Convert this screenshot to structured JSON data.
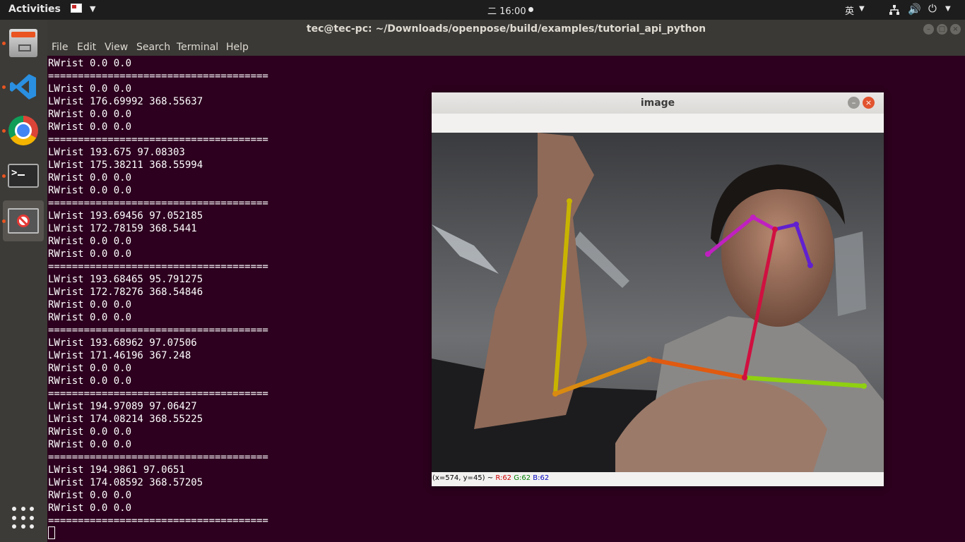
{
  "topbar": {
    "activities": "Activities",
    "clock": "二 16:00",
    "ime": "英",
    "status_icons": [
      "network-icon",
      "volume-icon",
      "power-icon"
    ]
  },
  "dock": {
    "apps": [
      "files-icon",
      "vscode-icon",
      "chrome-icon",
      "terminal-icon",
      "blocked-app-icon"
    ]
  },
  "terminal": {
    "title": "tec@tec-pc: ~/Downloads/openpose/build/examples/tutorial_api_python",
    "menu": [
      "File",
      "Edit",
      "View",
      "Search",
      "Terminal",
      "Help"
    ],
    "lines": [
      "RWrist 0.0 0.0",
      "=====================================",
      "LWrist 0.0 0.0",
      "LWrist 176.69992 368.55637",
      "RWrist 0.0 0.0",
      "RWrist 0.0 0.0",
      "=====================================",
      "LWrist 193.675 97.08303",
      "LWrist 175.38211 368.55994",
      "RWrist 0.0 0.0",
      "RWrist 0.0 0.0",
      "=====================================",
      "LWrist 193.69456 97.052185",
      "LWrist 172.78159 368.5441",
      "RWrist 0.0 0.0",
      "RWrist 0.0 0.0",
      "=====================================",
      "LWrist 193.68465 95.791275",
      "LWrist 172.78276 368.54846",
      "RWrist 0.0 0.0",
      "RWrist 0.0 0.0",
      "=====================================",
      "LWrist 193.68962 97.07506",
      "LWrist 171.46196 367.248",
      "RWrist 0.0 0.0",
      "RWrist 0.0 0.0",
      "=====================================",
      "LWrist 194.97089 97.06427",
      "LWrist 174.08214 368.55225",
      "RWrist 0.0 0.0",
      "RWrist 0.0 0.0",
      "=====================================",
      "LWrist 194.9861 97.0651",
      "LWrist 174.08592 368.57205",
      "RWrist 0.0 0.0",
      "RWrist 0.0 0.0",
      "====================================="
    ]
  },
  "image_window": {
    "title": "image",
    "status_coords": "(x=574, y=45) ~",
    "status_r": "R:62",
    "status_g": "G:62",
    "status_b": "B:62"
  },
  "colors": {
    "terminal_bg": "#2c001e",
    "accent": "#e95420"
  }
}
